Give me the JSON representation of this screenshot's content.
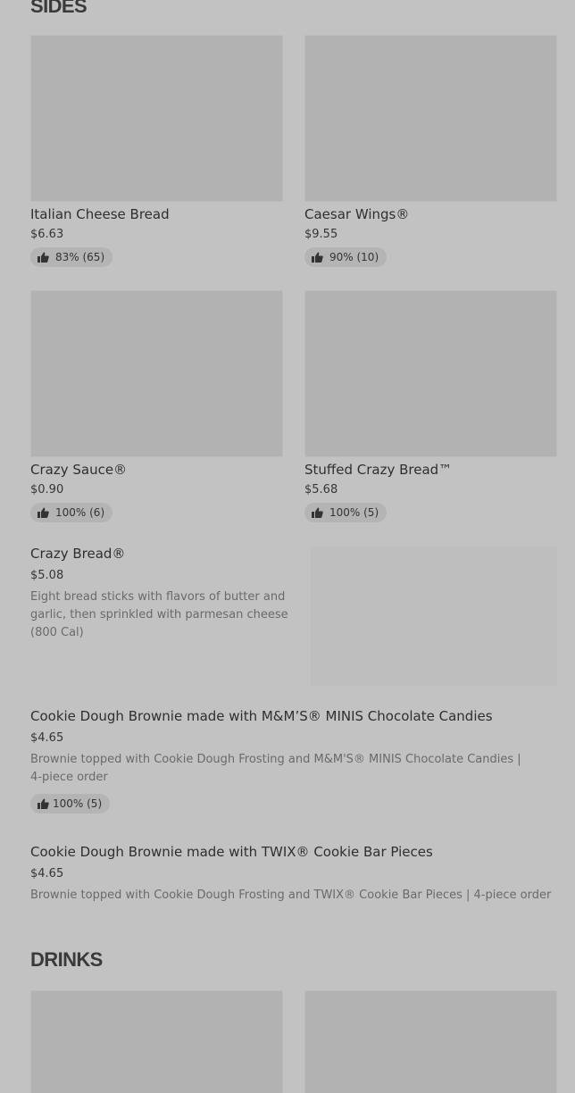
{
  "sides": {
    "title": "SIDES",
    "cards": [
      {
        "name": "Italian Cheese Bread",
        "price": "$6.63",
        "rating": "83% (65)"
      },
      {
        "name": "Caesar Wings®",
        "price": "$9.55",
        "rating": "90% (10)"
      },
      {
        "name": "Crazy Sauce®",
        "price": "$0.90",
        "rating": "100% (6)"
      },
      {
        "name": "Stuffed Crazy Bread™",
        "price": "$5.68",
        "rating": "100% (5)"
      }
    ],
    "list": [
      {
        "name": "Crazy Bread®",
        "price": "$5.08",
        "description": "Eight bread sticks with flavors of butter and garlic, then sprinkled with parmesan cheese (800 Cal)"
      },
      {
        "name": "Cookie Dough Brownie made with M&M’S® MINIS Chocolate Candies",
        "price": "$4.65",
        "description": "Brownie topped with Cookie Dough Frosting and M&M'S® MINIS Chocolate Candies | 4-piece order",
        "rating": "100% (5)"
      },
      {
        "name": "Cookie Dough Brownie made with TWIX® Cookie Bar Pieces",
        "price": "$4.65",
        "description": "Brownie topped with Cookie Dough Frosting and TWIX® Cookie Bar Pieces | 4-piece order"
      }
    ]
  },
  "drinks": {
    "title": "DRINKS"
  },
  "icons": {
    "rating": "thumbs-up-icon"
  }
}
